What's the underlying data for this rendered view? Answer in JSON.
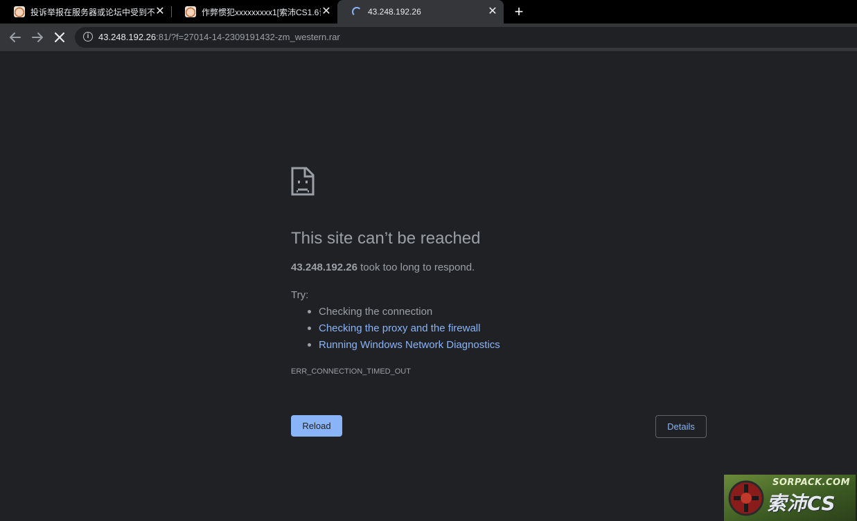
{
  "tabs": [
    {
      "title": "投诉举报在服务器或论坛中受到不",
      "favicon": "anime-avatar-icon"
    },
    {
      "title": "作弊惯犯xxxxxxxxx1[索沛CS1.6论",
      "favicon": "anime-avatar-icon"
    },
    {
      "title": "43.248.192.26",
      "favicon": "loading-spinner-icon",
      "active": true
    }
  ],
  "toolbar": {
    "url_host": "43.248.192.26",
    "url_rest": ":81/?f=27014-14-2309191432-zm_western.rar"
  },
  "error": {
    "heading": "This site can’t be reached",
    "host": "43.248.192.26",
    "summary_suffix": " took too long to respond.",
    "try_label": "Try:",
    "suggestions": [
      "Checking the connection",
      "Checking the proxy and the firewall",
      "Running Windows Network Diagnostics"
    ],
    "error_code": "ERR_CONNECTION_TIMED_OUT",
    "reload_label": "Reload",
    "details_label": "Details"
  },
  "watermark": {
    "top_text": "SORPACK.COM",
    "main_text": "索沛CS"
  },
  "colors": {
    "background": "#202124",
    "text": "#9aa0a6",
    "link": "#8ab4f8",
    "toolbar": "#35363a"
  }
}
